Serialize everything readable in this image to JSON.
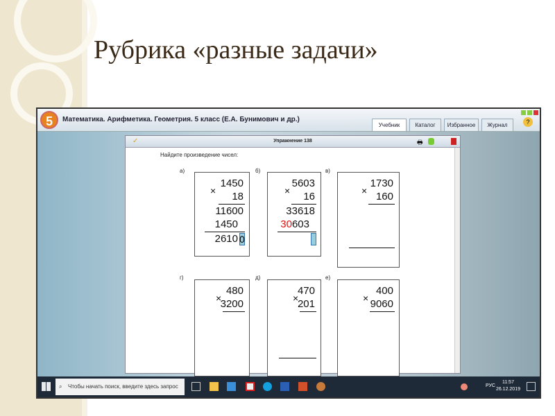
{
  "slide": {
    "title": "Рубрика «разные задачи»"
  },
  "app": {
    "logo": "5",
    "title": "Математика. Арифметика. Геометрия. 5 класс (Е.А. Бунимович и др.)",
    "tabs": [
      "Учебник",
      "Каталог",
      "Избранное",
      "Журнал"
    ],
    "help": "?"
  },
  "exercise": {
    "title": "Упражнение 138",
    "task": "Найдите произведение чисел:",
    "problems": [
      {
        "label": "а)",
        "a": "1450",
        "b": "18",
        "p1": "11600",
        "p2": "1450",
        "result_black": "2610",
        "result_red": "",
        "result_tail": "0"
      },
      {
        "label": "б)",
        "a": "5603",
        "b": "16",
        "p1": "33618",
        "p2_red": "30",
        "p2": "603"
      },
      {
        "label": "в)",
        "a": "1730",
        "b": "160"
      },
      {
        "label": "г)",
        "a": "480",
        "b": "3200"
      },
      {
        "label": "д)",
        "a": "470",
        "b": "201"
      },
      {
        "label": "е)",
        "a": "400",
        "b": "9060"
      }
    ],
    "times": "×"
  },
  "taskbar": {
    "search_placeholder": "Чтобы начать поиск, введите здесь запрос",
    "lang": "РУС",
    "time": "11:57",
    "date": "26.12.2019"
  },
  "colors": {
    "accent": "#e8821e",
    "title": "#3b2a18",
    "red": "#e01010"
  }
}
